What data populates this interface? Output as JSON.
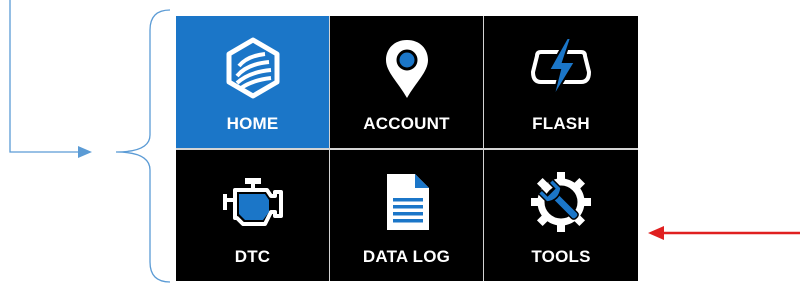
{
  "menu": {
    "tiles": [
      {
        "label": "HOME",
        "icon": "home-hexagon-icon",
        "active": true
      },
      {
        "label": "ACCOUNT",
        "icon": "location-pin-icon",
        "active": false
      },
      {
        "label": "FLASH",
        "icon": "lightning-bolt-icon",
        "active": false
      },
      {
        "label": "DTC",
        "icon": "engine-icon",
        "active": false
      },
      {
        "label": "DATA LOG",
        "icon": "document-icon",
        "active": false
      },
      {
        "label": "TOOLS",
        "icon": "gear-wrench-icon",
        "active": false
      }
    ]
  },
  "colors": {
    "active_tile": "#1b76c8",
    "tile_bg": "#000000",
    "icon_accent": "#1b76c8",
    "bracket_line": "#5b9bd5",
    "arrow_red": "#e02020"
  }
}
